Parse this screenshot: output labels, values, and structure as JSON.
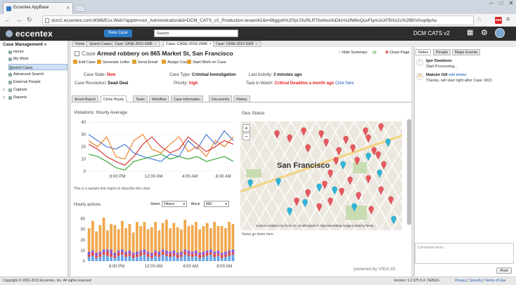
{
  "browser": {
    "tab_title": "Eccentex AppBase",
    "url": "dcm2.eccentex.com:8086/Ecx.Web?appid=root_Administration&d=DCM_CATS_v2_Production.tenant41&t=68ggx8%2f3yIJSvRLRTbx6es0oDko%2fM6xQuvFIymJsXFBXx2c%2fBhVAop6pAu"
  },
  "app": {
    "logo": "eccentex",
    "new_case_label": "New Case",
    "search_placeholder": "Search",
    "app_name": "DCM CATS v2"
  },
  "sidebar": {
    "header": "Case Management",
    "items": [
      {
        "label": "Home"
      },
      {
        "label": "My Work"
      },
      {
        "label": "Search Cases"
      },
      {
        "label": "Advanced Search"
      },
      {
        "label": "External People"
      },
      {
        "label": "Capture"
      },
      {
        "label": "Reports"
      }
    ]
  },
  "main_tabs": [
    "Home",
    "Search Cases",
    "Case: CASE-2015-3388",
    "Case: CASE-2015-2946",
    "Case: CASE-2015-3366"
  ],
  "case": {
    "type_label": "Case",
    "title": "Armed robbery on 865 Market St, San Francisco",
    "hide_summary": "Hide Summary",
    "close_page": "Close Page",
    "actions": [
      "Edit Case",
      "Generate Letter",
      "Send Email",
      "Assign Case",
      "Start Work on Case"
    ],
    "fields": {
      "state_label": "Case State:",
      "state_value": "New",
      "resolution_label": "Case Resolution:",
      "resolution_value": "Dead Deal",
      "type_label": "Case Type:",
      "type_value": "Criminal Investigation",
      "priority_label": "Priority:",
      "priority_value": "high",
      "activity_label": "Last Activity:",
      "activity_value": "3 minutes ago",
      "task_label": "Task to Watch:",
      "task_value": "Critical Deadline a month ago",
      "task_link": "Click here"
    },
    "sub_tabs": [
      "Arrest Report",
      "Crime Hourly",
      "Tasks",
      "Workflow",
      "Case Information",
      "Documents",
      "History"
    ]
  },
  "violations": {
    "title": "Violations: Hourly Average",
    "note": "This is a sample text region to describe this chart."
  },
  "geo": {
    "title": "Geo Status",
    "city": "San Francisco",
    "attribution": "Custom Analytics by Kevin IO, SI Metropolis © OpenStreetMap Imagery data by Nieta...",
    "note": "Notes go down here",
    "powered": "powered by VIDA.IO"
  },
  "hourly": {
    "title": "Hourly actions",
    "street_label": "Street",
    "street_value": "Filbern",
    "block_label": "Block",
    "block_value": "800"
  },
  "right_panel": {
    "tabs": [
      "Notes",
      "People",
      "Major Events"
    ],
    "messages": [
      {
        "initial": "I",
        "name": "Igor Davidson",
        "text": "Start Processing..."
      },
      {
        "initial": "M",
        "name": "Maksim Gill",
        "edit": "edit",
        "delete": "delete",
        "text": "Thanks, will start right after Case 1821"
      }
    ],
    "comment_placeholder": "Comment here...",
    "post_label": "Post"
  },
  "footer": {
    "copyright": "Copyright © 2001-2015 Eccentex, Inc. All rights reserved",
    "version": "Version: 5.2.975.5.4",
    "env": "DEBUG",
    "privacy": "Privacy",
    "security": "Security",
    "terms": "Terms of Use"
  },
  "chart_data": [
    {
      "type": "line",
      "title": "Violations: Hourly Average",
      "x_ticks": [
        "8:00 PM",
        "12:00 AM",
        "4:00 AM",
        "8:00 AM"
      ],
      "y_ticks": [
        0,
        10,
        20,
        30,
        40
      ],
      "ylim": [
        0,
        40
      ],
      "series": [
        {
          "color": "#3b6fd4",
          "values": [
            30,
            25,
            20,
            18,
            22,
            15,
            12,
            10,
            8,
            14,
            12,
            25,
            18,
            30,
            22,
            33,
            25
          ]
        },
        {
          "color": "#f07b1d",
          "values": [
            25,
            20,
            28,
            12,
            10,
            25,
            30,
            18,
            15,
            22,
            28,
            16,
            20,
            12,
            25,
            20,
            28
          ]
        },
        {
          "color": "#d62728",
          "values": [
            22,
            18,
            12,
            8,
            5,
            12,
            22,
            28,
            20,
            15,
            18,
            28,
            22,
            16,
            20,
            25,
            22
          ]
        },
        {
          "color": "#2ca02c",
          "values": [
            14,
            12,
            8,
            3,
            1,
            8,
            10,
            12,
            14,
            10,
            12,
            10,
            12,
            8,
            10,
            12,
            8
          ]
        }
      ]
    },
    {
      "type": "bar",
      "title": "Hourly actions",
      "x_ticks": [
        "8:00 PM",
        "12:00 AM",
        "4:00 AM",
        "8:00 AM"
      ],
      "y_ticks": [
        0,
        10,
        20,
        30,
        40
      ],
      "ylim": [
        0,
        45
      ],
      "series": [
        {
          "color": "#6aa6e6",
          "values": [
            4,
            5,
            3,
            4,
            6,
            5,
            4,
            3,
            5,
            6,
            4,
            5,
            3,
            4,
            5,
            6,
            4,
            3,
            5,
            4,
            6,
            5,
            4,
            5,
            3,
            4,
            6,
            5,
            4,
            5,
            3,
            4,
            5,
            6,
            4,
            5,
            3,
            4,
            5,
            6
          ]
        },
        {
          "color": "#e24a4a",
          "values": [
            2,
            3,
            2,
            3,
            2,
            4,
            3,
            2,
            3,
            2,
            3,
            2,
            3,
            2,
            3,
            2,
            3,
            2,
            3,
            2,
            3,
            2,
            3,
            2,
            3,
            2,
            3,
            2,
            3,
            2,
            3,
            2,
            3,
            2,
            3,
            2,
            3,
            2,
            3,
            2
          ]
        },
        {
          "color": "#8b5bd2",
          "values": [
            3,
            2,
            3,
            2,
            3,
            2,
            4,
            3,
            2,
            3,
            2,
            3,
            2,
            3,
            2,
            3,
            2,
            3,
            2,
            3,
            2,
            3,
            2,
            3,
            2,
            3,
            2,
            3,
            2,
            3,
            2,
            3,
            2,
            3,
            2,
            3,
            2,
            3,
            2,
            3
          ]
        },
        {
          "color": "#f0a84e",
          "values": [
            22,
            28,
            20,
            25,
            30,
            18,
            24,
            26,
            20,
            27,
            22,
            25,
            19,
            28,
            23,
            26,
            21,
            24,
            27,
            20,
            25,
            29,
            22,
            26,
            24,
            21,
            28,
            23,
            25,
            27,
            22,
            24,
            26,
            20,
            28,
            23,
            25,
            22,
            27,
            24
          ]
        }
      ]
    }
  ]
}
